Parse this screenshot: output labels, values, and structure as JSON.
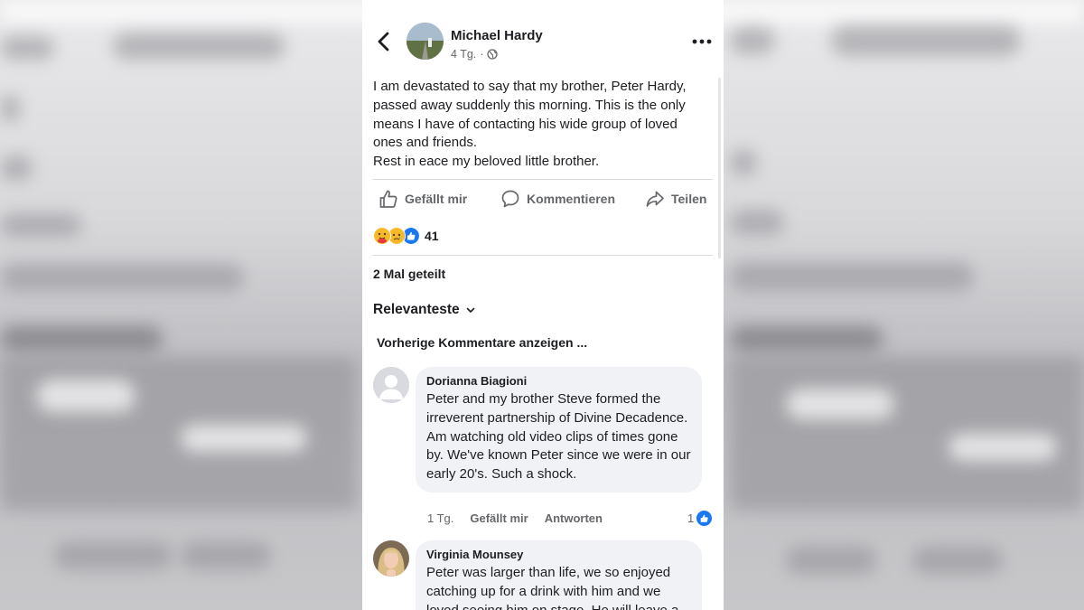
{
  "post": {
    "author": "Michael Hardy",
    "time": "4 Tg.",
    "separator": "·",
    "text_lines": [
      "I am devastated to say that my brother, Peter Hardy, passed away suddenly this morning. This is the only means I have of contacting his wide group of loved ones and friends.",
      "Rest in eace my beloved little brother."
    ]
  },
  "actions": {
    "like": "Gefällt mir",
    "comment": "Kommentieren",
    "share": "Teilen"
  },
  "reactions": {
    "icons": [
      "care-emoji",
      "sad-emoji",
      "like-emoji"
    ],
    "count": "41"
  },
  "shares": "2 Mal geteilt",
  "sort_label": "Relevanteste",
  "previous_comments": "Vorherige Kommentare anzeigen ...",
  "comments": [
    {
      "name": "Dorianna Biagioni",
      "text": "Peter and my brother Steve formed the irreverent partnership of Divine Decadence.   Am watching old video clips of times gone by.   We've known Peter since we were in our early 20's.   Such a shock.",
      "time": "1 Tg.",
      "like": "Gefällt mir",
      "reply": "Antworten",
      "likes": "1"
    },
    {
      "name": "Virginia Mounsey",
      "text": "Peter was larger than life, we so enjoyed catching up for a drink with him and we loved seeing him on stage. He will leave a"
    }
  ],
  "colors": {
    "text_primary": "#1c1e21",
    "text_secondary": "#65676b",
    "bubble": "#f0f2f5",
    "like_blue": "#1877f2"
  }
}
